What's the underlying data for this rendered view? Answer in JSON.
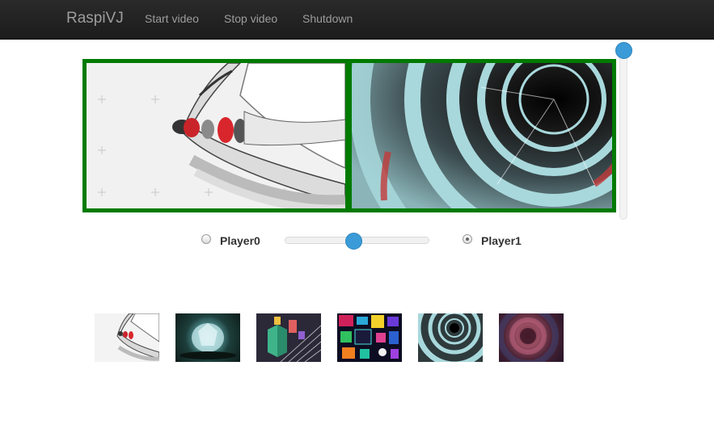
{
  "navbar": {
    "brand": "RaspiVJ",
    "links": [
      {
        "label": "Start video"
      },
      {
        "label": "Stop video"
      },
      {
        "label": "Shutdown"
      }
    ]
  },
  "players": {
    "left": {
      "label": "Player0",
      "selected": false
    },
    "right": {
      "label": "Player1",
      "selected": true
    },
    "crossfade": 0.48
  },
  "opacity_slider": {
    "value": 1.0
  },
  "colors": {
    "navbar_bg": "#222222",
    "nav_text": "#9d9d9d",
    "frame_border": "#008000",
    "slider_knob": "#3a9bd8"
  },
  "thumbnails": [
    {
      "name": "spaceship-clip"
    },
    {
      "name": "crystal-clip"
    },
    {
      "name": "isometric-city-clip"
    },
    {
      "name": "neon-grid-clip"
    },
    {
      "name": "tunnel-clip"
    },
    {
      "name": "blur-tunnel-clip"
    }
  ]
}
